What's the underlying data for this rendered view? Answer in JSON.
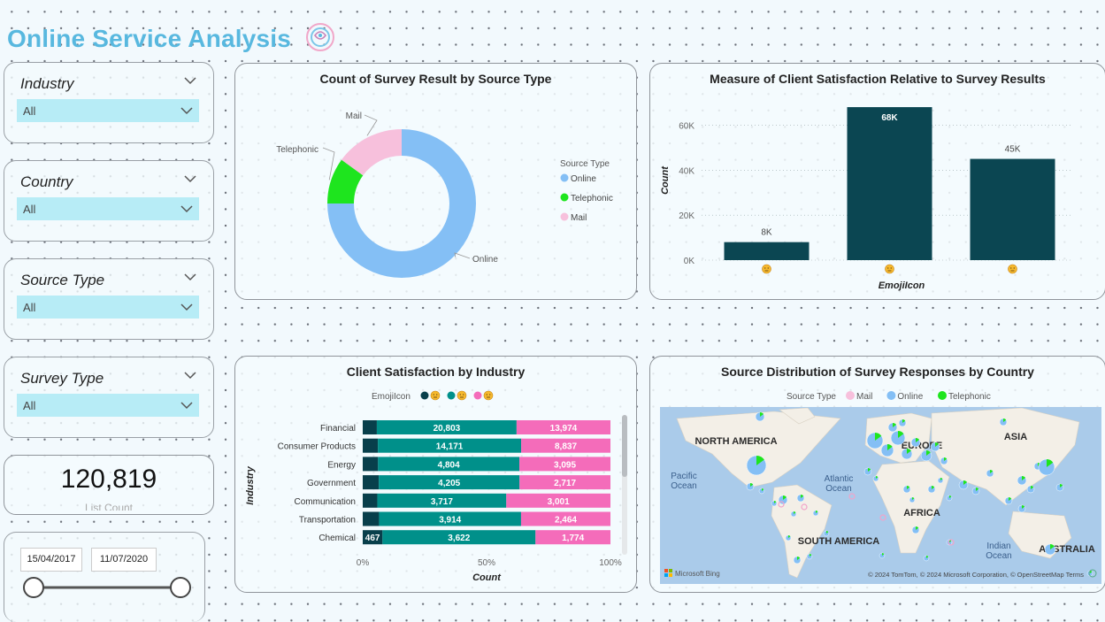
{
  "header": {
    "title": "Online  Service Analysis"
  },
  "slicers": [
    {
      "label": "Industry",
      "value": "All"
    },
    {
      "label": "Country",
      "value": "All"
    },
    {
      "label": "Source Type",
      "value": "All"
    },
    {
      "label": "Survey Type",
      "value": "All"
    }
  ],
  "kpi": {
    "value": "120,819",
    "label": "List Count"
  },
  "date_range": {
    "start": "15/04/2017",
    "end": "11/07/2020",
    "start_fraction": 0,
    "end_fraction": 1
  },
  "donut": {
    "title": "Count of Survey Result  by Source Type",
    "legend_title": "Source Type",
    "slices": [
      {
        "name": "Online",
        "value": 0.75,
        "color": "#84bff5"
      },
      {
        "name": "Telephonic",
        "value": 0.1,
        "color": "#1ee51e"
      },
      {
        "name": "Mail",
        "value": 0.15,
        "color": "#f7c0dc"
      }
    ]
  },
  "chart_data": [
    {
      "type": "bar",
      "title": "Measure of Client Satisfaction Relative to Survey Results",
      "xlabel": "EmojiIcon",
      "ylabel": "Count",
      "categories": [
        "😠",
        "😐",
        "😊"
      ],
      "values": [
        8000,
        68000,
        45000
      ],
      "data_labels": [
        "8K",
        "68K",
        "45K"
      ],
      "yticks": [
        "0K",
        "20K",
        "40K",
        "60K"
      ],
      "ylim": [
        0,
        70000
      ],
      "color": "#0b4652"
    },
    {
      "type": "bar",
      "title": "Client Satisfaction by Industry",
      "xlabel": "Count",
      "ylabel": "Industry",
      "legend_title": "EmojiIcon",
      "categories": [
        "Financial",
        "Consumer Products",
        "Energy",
        "Government",
        "Communication",
        "Transportation",
        "Chemical"
      ],
      "series": [
        {
          "values": [
            2100,
            1500,
            520,
            480,
            420,
            450,
            467
          ],
          "color": "#083f4b"
        },
        {
          "values": [
            20803,
            14171,
            4804,
            4205,
            3717,
            3914,
            3622
          ],
          "color": "#00908a"
        },
        {
          "values": [
            13974,
            8837,
            3095,
            2717,
            3001,
            2464,
            1774
          ],
          "color": "#f46cba"
        }
      ],
      "labels": [
        [
          "",
          "20,803",
          "13,974"
        ],
        [
          "",
          "14,171",
          "8,837"
        ],
        [
          "",
          "4,804",
          "3,095"
        ],
        [
          "",
          "4,205",
          "2,717"
        ],
        [
          "",
          "3,717",
          "3,001"
        ],
        [
          "",
          "3,914",
          "2,464"
        ],
        [
          "467",
          "3,622",
          "1,774"
        ]
      ],
      "xticks": [
        "0%",
        "50%",
        "100%"
      ],
      "stacked": "100%"
    }
  ],
  "map": {
    "title": "Source Distribution of Survey Responses by Country",
    "legend_title": "Source Type",
    "legend": [
      {
        "name": "Mail",
        "color": "#f7c0dc"
      },
      {
        "name": "Online",
        "color": "#84bff5"
      },
      {
        "name": "Telephonic",
        "color": "#1ee51e"
      }
    ],
    "labels": [
      "NORTH AMERICA",
      "EUROPE",
      "ASIA",
      "Pacific\nOcean",
      "Atlantic\nOcean",
      "AFRICA",
      "SOUTH AMERICA",
      "Indian\nOcean",
      "AUSTRALIA"
    ],
    "bing": "Microsoft Bing",
    "attribution": "© 2024 TomTom, © 2024 Microsoft Corporation, © OpenStreetMap  Terms"
  }
}
